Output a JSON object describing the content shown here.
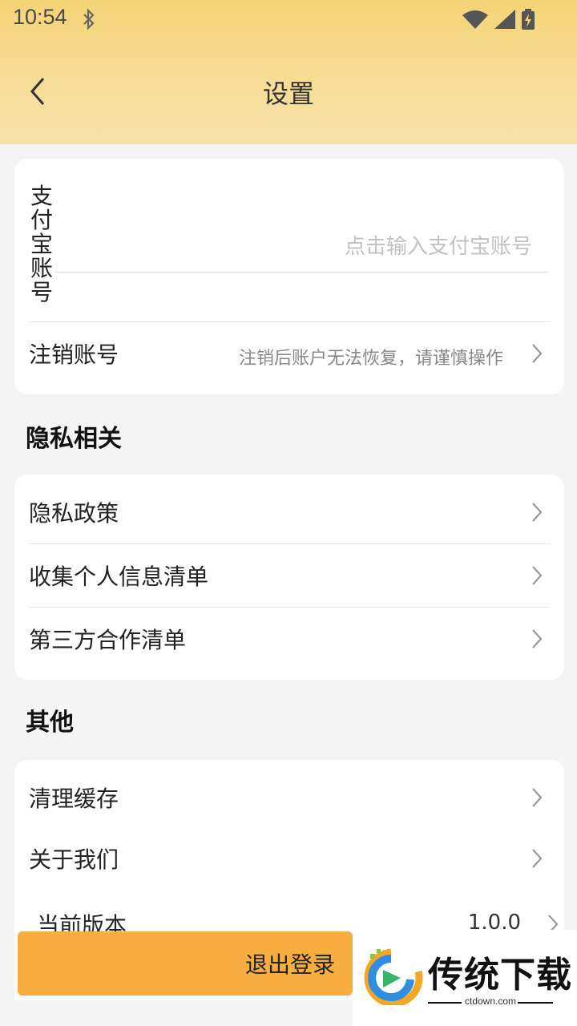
{
  "status_bar": {
    "time": "10:54"
  },
  "header": {
    "title": "设置"
  },
  "account": {
    "alipay_label": "支付宝账号",
    "alipay_placeholder": "点击输入支付宝账号",
    "cancel_label": "注销账号",
    "cancel_hint": "注销后账户无法恢复，请谨慎操作"
  },
  "privacy": {
    "section_title": "隐私相关",
    "items": [
      {
        "label": "隐私政策"
      },
      {
        "label": "收集个人信息清单"
      },
      {
        "label": "第三方合作清单"
      }
    ]
  },
  "other": {
    "section_title": "其他",
    "items": [
      {
        "label": "清理缓存"
      },
      {
        "label": "关于我们"
      },
      {
        "label": "当前版本",
        "value": "1.0.0"
      }
    ]
  },
  "logout": {
    "label": "退出登录"
  },
  "watermark": {
    "name": "传统下载",
    "url": "ctdown.com"
  },
  "colors": {
    "accent": "#f8ae3f",
    "header_top": "#f5d476",
    "header_bottom": "#f6e2ae"
  }
}
